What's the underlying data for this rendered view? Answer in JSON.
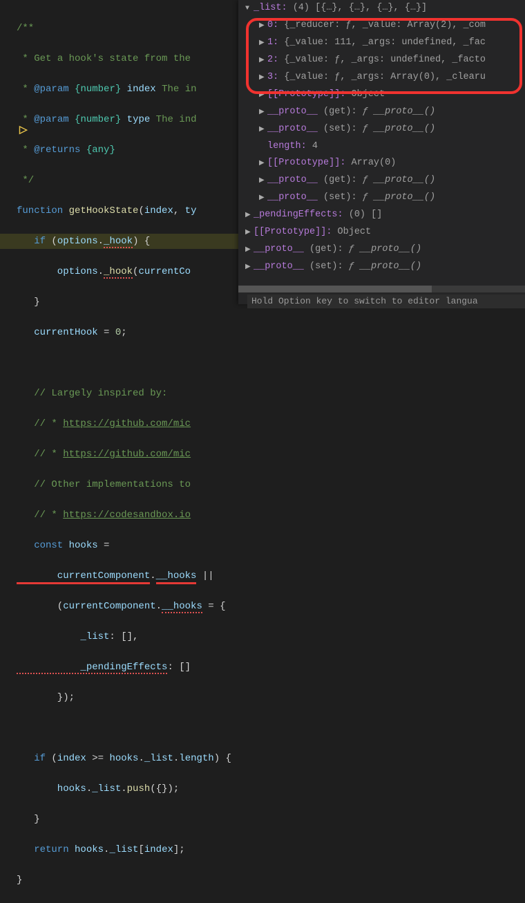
{
  "code": {
    "l1": "/**",
    "l2a": " * ",
    "l2b": "Get a hook's state from the ",
    "l3a": " * ",
    "l3b": "@param",
    "l3c": " {number}",
    "l3d": " index",
    "l3e": " The in",
    "l4a": " * ",
    "l4b": "@param",
    "l4c": " {number}",
    "l4d": " type",
    "l4e": " The ind",
    "l5a": " * ",
    "l5b": "@returns",
    "l5c": " {any}",
    "l6": " */",
    "l7a": "function",
    "l7b": " getHookState",
    "l7c": "(",
    "l7d": "index",
    "l7e": ", ",
    "l7f": "ty",
    "l8a": "   if",
    "l8b": " (",
    "l8c": "options",
    "l8d": ".",
    "l8e": "_hook",
    "l8f": ") {",
    "l9a": "       options",
    "l9b": ".",
    "l9c": "_hook",
    "l9d": "(",
    "l9e": "currentCo",
    "l10": "   }",
    "l11a": "   currentHook",
    "l11b": " = ",
    "l11c": "0",
    "l11d": ";",
    "l13": "   // Largely inspired by:",
    "l14a": "   // * ",
    "l14b": "https://github.com/mic",
    "l15a": "   // * ",
    "l15b": "https://github.com/mic",
    "l16": "   // Other implementations to",
    "l17a": "   // * ",
    "l17b": "https://codesandbox.io",
    "l18a": "   const",
    "l18b": " hooks",
    "l18c": " =",
    "l19a": "       currentComponent",
    "l19b": ".",
    "l19c": "__hooks",
    "l19d": " ||",
    "l20a": "       (",
    "l20b": "currentComponent",
    "l20c": ".",
    "l20d": "__hooks",
    "l20e": " = {",
    "l21a": "           _list",
    "l21b": ": [],",
    "l22a": "           _pendingEffects",
    "l22b": ": []",
    "l23": "       });",
    "l25a": "   if",
    "l25b": " (",
    "l25c": "index",
    "l25d": " >= ",
    "l25e": "hooks",
    "l25f": ".",
    "l25g": "_list",
    "l25h": ".",
    "l25i": "length",
    "l25j": ") {",
    "l26a": "       hooks",
    "l26b": ".",
    "l26c": "_list",
    "l26d": ".",
    "l26e": "push",
    "l26f": "({});",
    "l27": "   }",
    "l28a": "   return",
    "l28b": " hooks",
    "l28c": ".",
    "l28d": "_list",
    "l28e": "[",
    "l28f": "index",
    "l28g": "];",
    "l29": "}"
  },
  "debug": {
    "header_key": "_list:",
    "header_val": " (4) [{…}, {…}, {…}, {…}]",
    "rows": [
      {
        "key": "0:",
        "val": " {_reducer: ƒ, _value: Array(2), _com"
      },
      {
        "key": "1:",
        "val": " {_value: 111, _args: undefined, _fac"
      },
      {
        "key": "2:",
        "val": " {_value: ƒ, _args: undefined, _facto"
      },
      {
        "key": "3:",
        "val": " {_value: ƒ, _args: Array(0), _clearu"
      }
    ],
    "proto1_key": "[[Prototype]]:",
    "proto1_val": " Object",
    "pg_key": "__proto__ ",
    "pg_get": "(get):",
    "pg_getv": " ƒ __proto__()",
    "pg_set": "(set):",
    "pg_setv": " ƒ __proto__()",
    "len_key": "length:",
    "len_val": " 4",
    "proto2_key": "[[Prototype]]:",
    "proto2_val": " Array(0)",
    "pending_key": "_pendingEffects:",
    "pending_val": " (0) []",
    "proto3_key": "[[Prototype]]:",
    "proto3_val": " Object"
  },
  "hint": "Hold Option key to switch to editor langua"
}
